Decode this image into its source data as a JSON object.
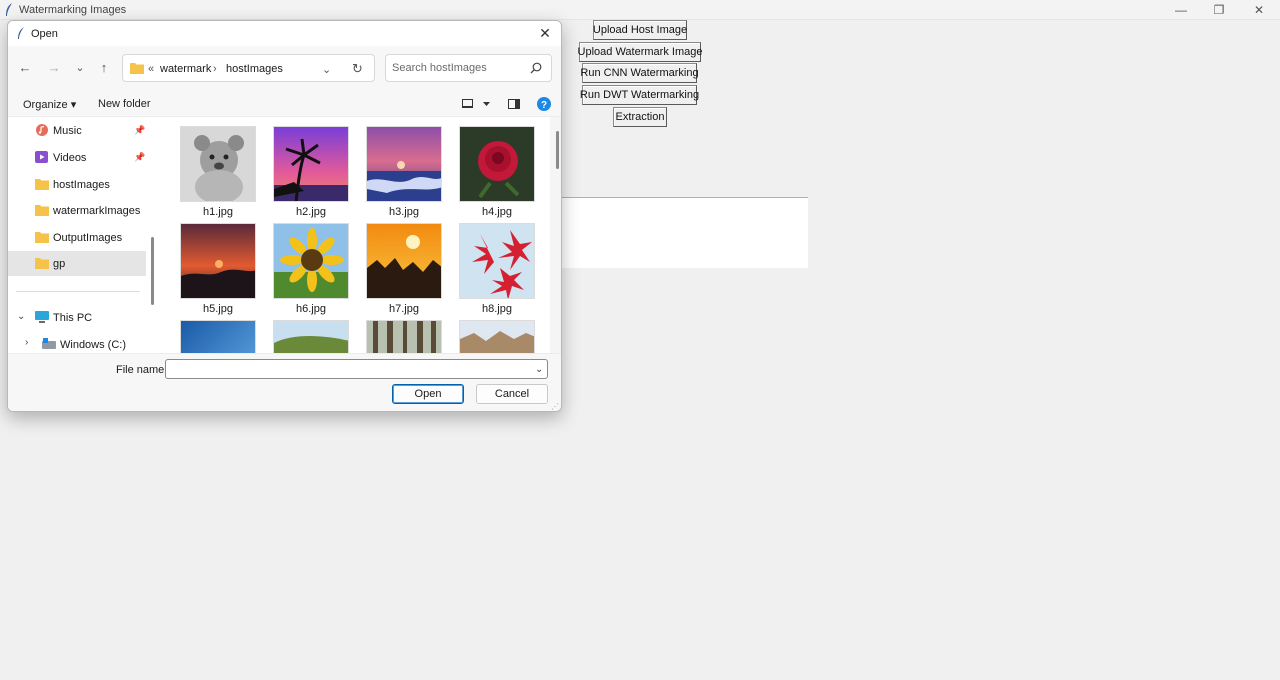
{
  "main_window": {
    "title": "Watermarking Images",
    "controls": {
      "minimize": "—",
      "restore": "❐",
      "close": "✕"
    },
    "buttons": {
      "upload_host": "Upload Host Image",
      "upload_watermark": "Upload Watermark Image",
      "run_cnn": "Run CNN Watermarking",
      "run_dwt": "Run DWT Watermarking",
      "extraction": "Extraction"
    }
  },
  "dialog": {
    "title": "Open",
    "close": "✕",
    "nav": {
      "back": "←",
      "forward": "→",
      "recent": "⌄",
      "up": "↑"
    },
    "address": {
      "overflow": "«",
      "segments": [
        "watermark",
        "hostImages"
      ],
      "separator": "›",
      "dropdown": "⌄",
      "refresh": "↻"
    },
    "search": {
      "placeholder": "Search hostImages"
    },
    "commands": {
      "organize": "Organize ▾",
      "new_folder": "New folder"
    },
    "nav_pane": [
      {
        "label": "Music",
        "icon": "music-icon",
        "pinned": true
      },
      {
        "label": "Videos",
        "icon": "videos-icon",
        "pinned": true
      },
      {
        "label": "hostImages",
        "icon": "folder-icon"
      },
      {
        "label": "watermarkImages",
        "icon": "folder-icon"
      },
      {
        "label": "OutputImages",
        "icon": "folder-icon"
      },
      {
        "label": "gp",
        "icon": "folder-icon",
        "selected": true
      },
      {
        "label": "This PC",
        "icon": "pc-icon",
        "expanded": true
      },
      {
        "label": "Windows (C:)",
        "icon": "drive-icon"
      }
    ],
    "files": [
      "h1.jpg",
      "h2.jpg",
      "h3.jpg",
      "h4.jpg",
      "h5.jpg",
      "h6.jpg",
      "h7.jpg",
      "h8.jpg"
    ],
    "filename_label": "File name:",
    "filename_value": "",
    "open_label": "Open",
    "cancel_label": "Cancel",
    "colors": {
      "accent": "#0063b1",
      "folder": "#f5c24a",
      "selected": "#e5e5e5"
    }
  }
}
